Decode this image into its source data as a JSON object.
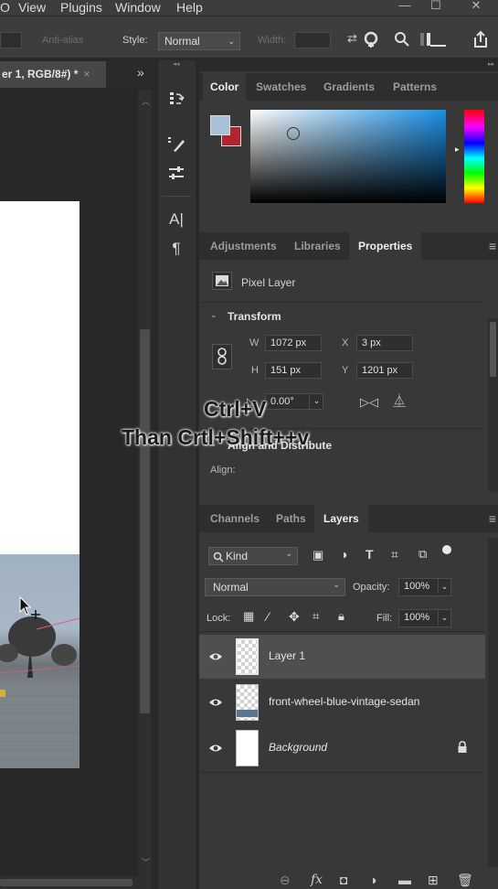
{
  "menubar": {
    "items": [
      "O",
      "View",
      "Plugins",
      "Window",
      "Help"
    ],
    "controls": [
      "—",
      "☐",
      "✕"
    ]
  },
  "options_bar": {
    "antialias_label": "Anti-alias",
    "style_label": "Style:",
    "style_value": "Normal",
    "width_label": "Width:"
  },
  "document": {
    "tab_title": "er 1, RGB/8#) *",
    "tab_close": "×",
    "tab_overflow": "»"
  },
  "tools": {
    "items": [
      {
        "name": "history-icon",
        "glyph": "⇋"
      },
      {
        "name": "brush-settings-icon",
        "glyph": "⁄"
      },
      {
        "name": "adjust-sliders-icon",
        "glyph": "☰"
      },
      {
        "name": "character-icon",
        "glyph": "A|"
      },
      {
        "name": "paragraph-icon",
        "glyph": "¶"
      }
    ]
  },
  "color_panel": {
    "tabs": [
      "Color",
      "Swatches",
      "Gradients",
      "Patterns"
    ],
    "active_tab": "Color",
    "foreground_color": "#a9c1d6",
    "background_color": "#b32431"
  },
  "properties_panel": {
    "tabs": [
      "Adjustments",
      "Libraries",
      "Properties"
    ],
    "active_tab": "Properties",
    "layer_type": "Pixel Layer",
    "transform_label": "Transform",
    "w_label": "W",
    "w_value": "1072 px",
    "x_label": "X",
    "x_value": "3 px",
    "h_label": "H",
    "h_value": "151 px",
    "y_label": "Y",
    "y_value": "1201 px",
    "angle_value": "0.00°",
    "align_section_label": "Align and Distribute",
    "align_label": "Align:"
  },
  "overlay": {
    "line1": "Ctrl+V",
    "line2": "Than Crtl+Shift++v"
  },
  "layers_panel": {
    "tabs": [
      "Channels",
      "Paths",
      "Layers"
    ],
    "active_tab": "Layers",
    "filter_value": "Kind",
    "blend_mode": "Normal",
    "opacity_label": "Opacity:",
    "opacity_value": "100%",
    "lock_label": "Lock:",
    "fill_label": "Fill:",
    "fill_value": "100%",
    "layers": [
      {
        "name": "Layer 1",
        "selected": true,
        "thumb": "transparent"
      },
      {
        "name": "front-wheel-blue-vintage-sedan",
        "selected": false,
        "thumb": "transparent"
      },
      {
        "name": "Background",
        "selected": false,
        "thumb": "white",
        "locked": true
      }
    ]
  }
}
